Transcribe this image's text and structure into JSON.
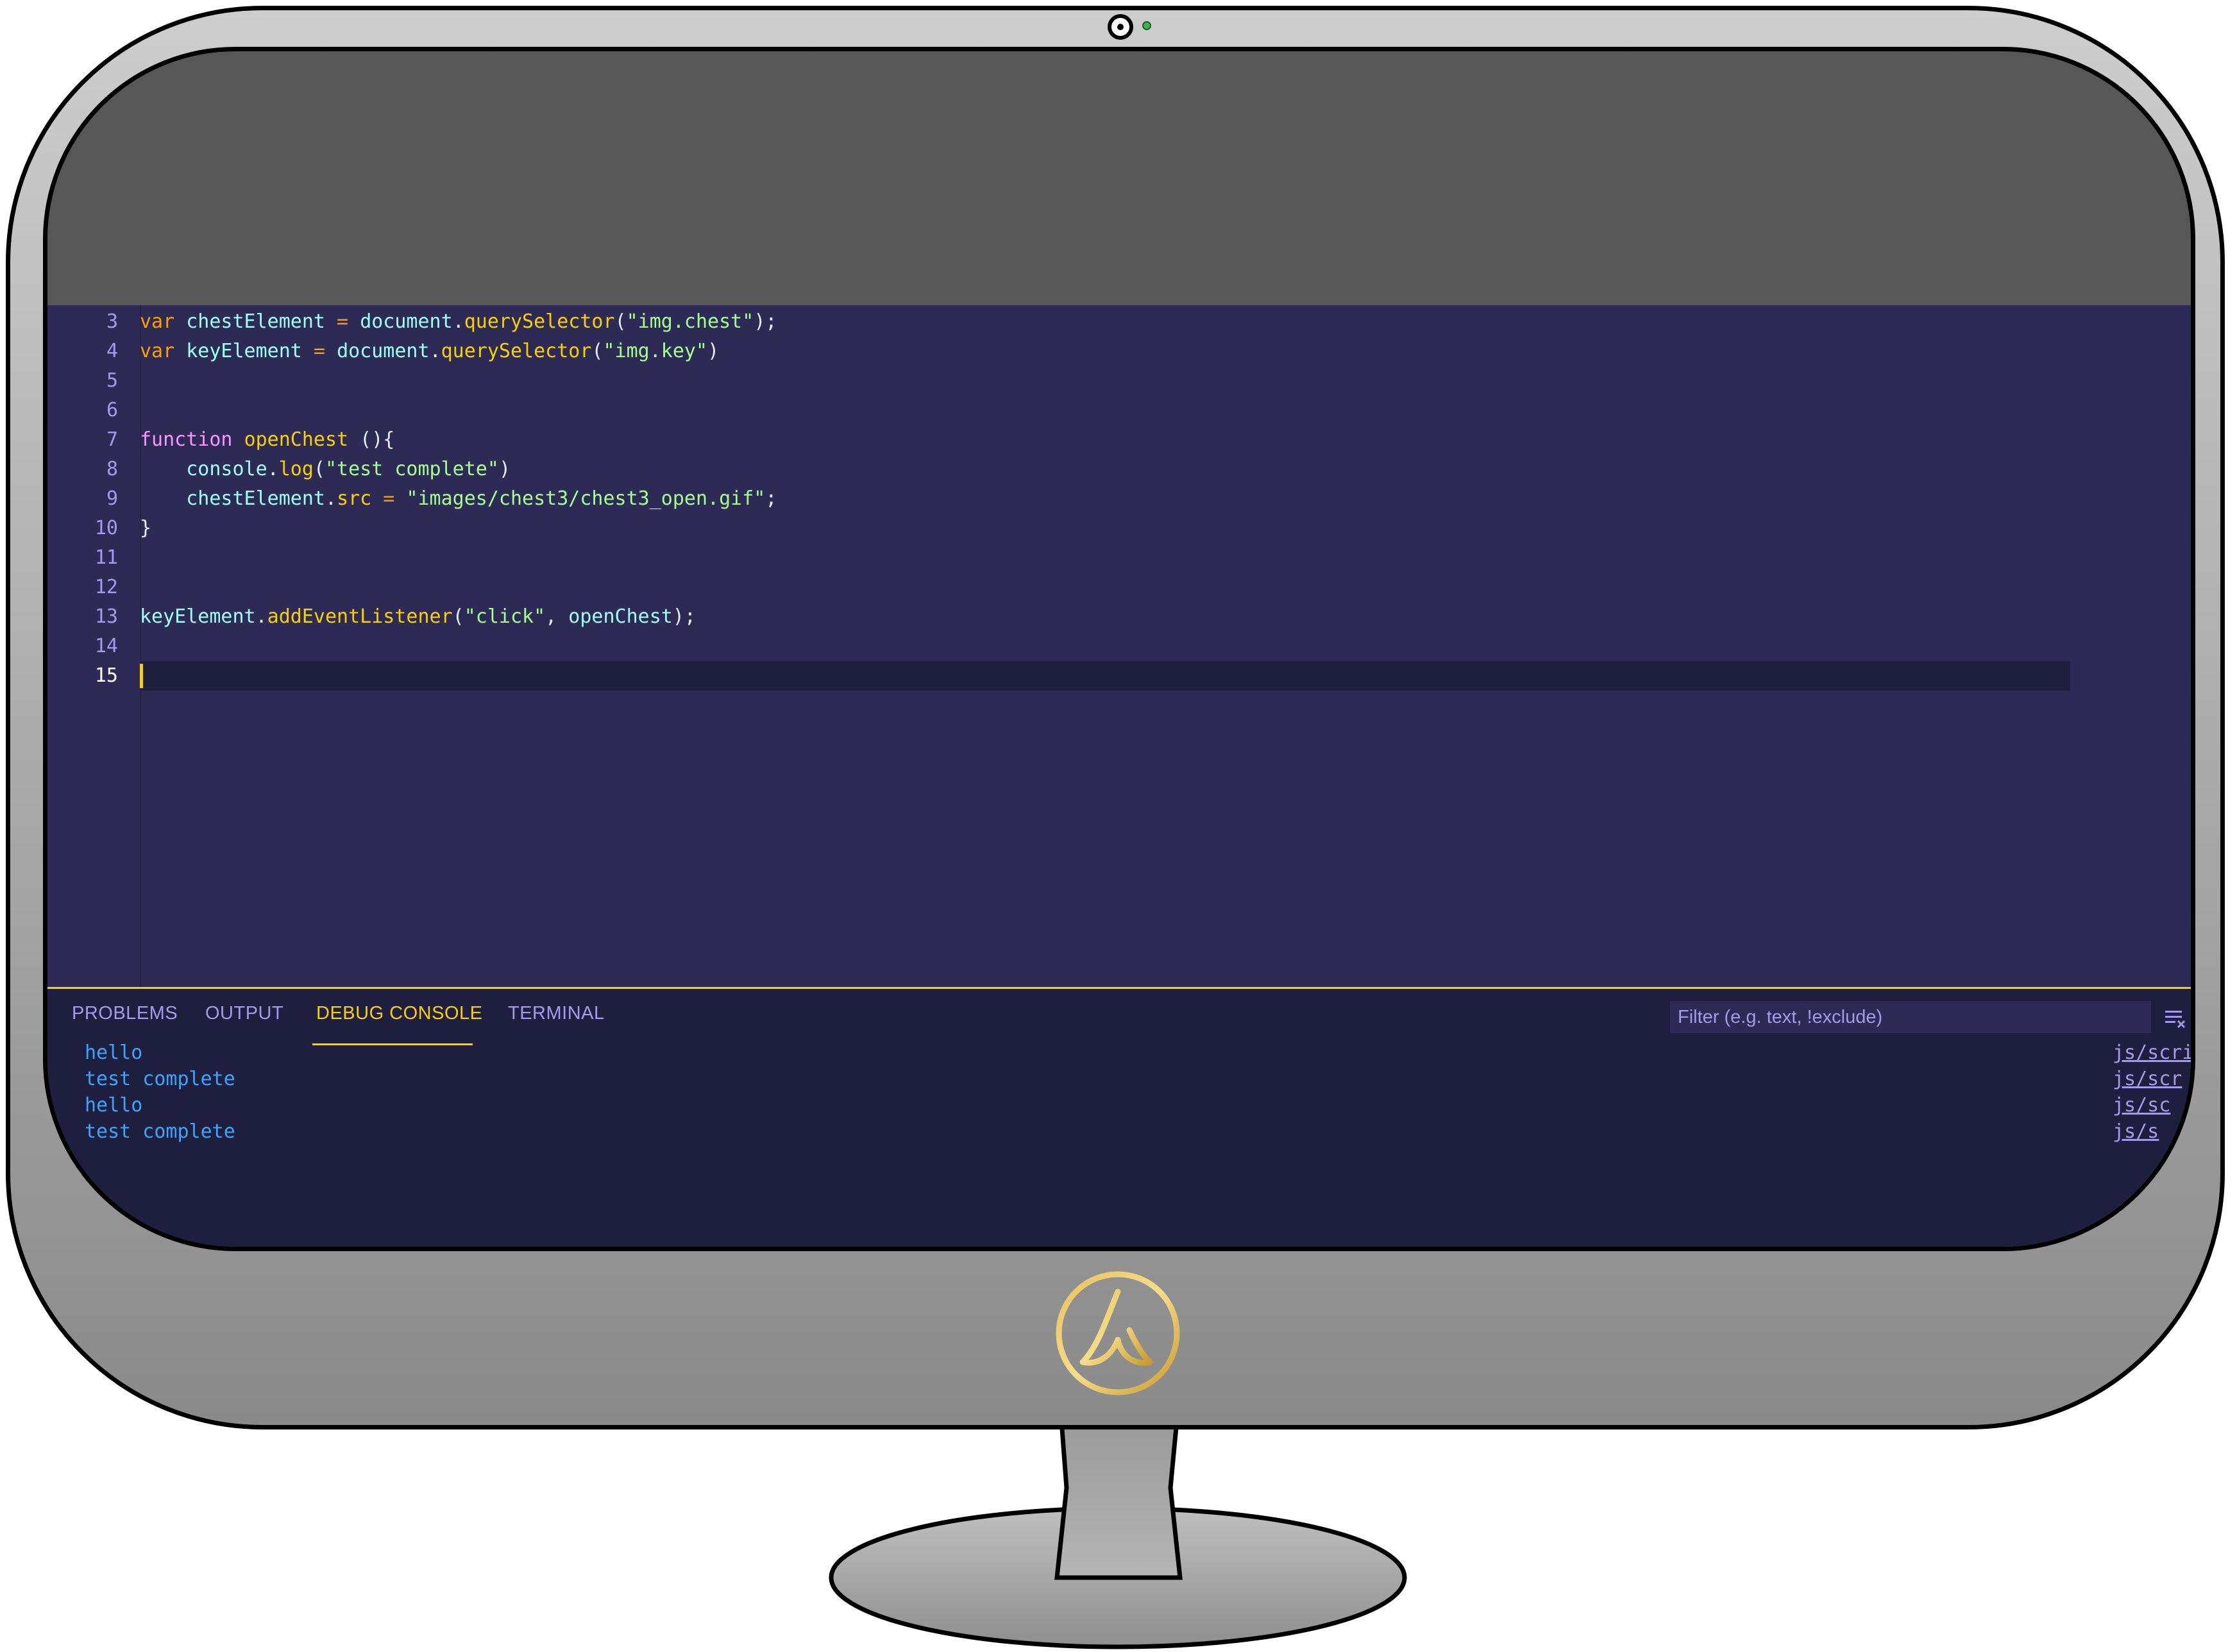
{
  "editor": {
    "lines": [
      {
        "num": "3",
        "tokens": [
          {
            "t": "var",
            "c": "kw"
          },
          {
            "t": " ",
            "c": "pl"
          },
          {
            "t": "chestElement",
            "c": "id"
          },
          {
            "t": " = ",
            "c": "pk"
          },
          {
            "t": "document",
            "c": "id"
          },
          {
            "t": ".",
            "c": "pl"
          },
          {
            "t": "querySelector",
            "c": "fn"
          },
          {
            "t": "(",
            "c": "pl"
          },
          {
            "t": "\"img.chest\"",
            "c": "str"
          },
          {
            "t": ");",
            "c": "pl"
          }
        ]
      },
      {
        "num": "4",
        "tokens": [
          {
            "t": "var",
            "c": "kw"
          },
          {
            "t": " ",
            "c": "pl"
          },
          {
            "t": "keyElement",
            "c": "id"
          },
          {
            "t": " = ",
            "c": "pk"
          },
          {
            "t": "document",
            "c": "id"
          },
          {
            "t": ".",
            "c": "pl"
          },
          {
            "t": "querySelector",
            "c": "fn"
          },
          {
            "t": "(",
            "c": "pl"
          },
          {
            "t": "\"img.key\"",
            "c": "str"
          },
          {
            "t": ")",
            "c": "pl"
          }
        ]
      },
      {
        "num": "5",
        "tokens": []
      },
      {
        "num": "6",
        "tokens": []
      },
      {
        "num": "7",
        "tokens": [
          {
            "t": "function",
            "c": "purp"
          },
          {
            "t": " ",
            "c": "pl"
          },
          {
            "t": "openChest",
            "c": "fn"
          },
          {
            "t": " (){",
            "c": "pl"
          }
        ]
      },
      {
        "num": "8",
        "tokens": [
          {
            "t": "    ",
            "c": "pl"
          },
          {
            "t": "console",
            "c": "id"
          },
          {
            "t": ".",
            "c": "pl"
          },
          {
            "t": "log",
            "c": "fn"
          },
          {
            "t": "(",
            "c": "pl"
          },
          {
            "t": "\"test complete\"",
            "c": "str"
          },
          {
            "t": ")",
            "c": "pl"
          }
        ]
      },
      {
        "num": "9",
        "tokens": [
          {
            "t": "    ",
            "c": "pl"
          },
          {
            "t": "chestElement",
            "c": "id"
          },
          {
            "t": ".",
            "c": "pl"
          },
          {
            "t": "src",
            "c": "fn"
          },
          {
            "t": " = ",
            "c": "pk"
          },
          {
            "t": "\"images/chest3/chest3_open.gif\"",
            "c": "str"
          },
          {
            "t": ";",
            "c": "pl"
          }
        ]
      },
      {
        "num": "10",
        "tokens": [
          {
            "t": "}",
            "c": "pl"
          }
        ]
      },
      {
        "num": "11",
        "tokens": []
      },
      {
        "num": "12",
        "tokens": []
      },
      {
        "num": "13",
        "tokens": [
          {
            "t": "keyElement",
            "c": "id"
          },
          {
            "t": ".",
            "c": "pl"
          },
          {
            "t": "addEventListener",
            "c": "fn"
          },
          {
            "t": "(",
            "c": "pl"
          },
          {
            "t": "\"click\"",
            "c": "str"
          },
          {
            "t": ", ",
            "c": "pl"
          },
          {
            "t": "openChest",
            "c": "id"
          },
          {
            "t": ");",
            "c": "pl"
          }
        ]
      },
      {
        "num": "14",
        "tokens": []
      },
      {
        "num": "15",
        "tokens": [],
        "active": true
      }
    ]
  },
  "panel": {
    "tabs": [
      {
        "label": "PROBLEMS",
        "active": false
      },
      {
        "label": "OUTPUT",
        "active": false
      },
      {
        "label": "DEBUG CONSOLE",
        "active": true
      },
      {
        "label": "TERMINAL",
        "active": false
      }
    ],
    "filter_placeholder": "Filter (e.g. text, !exclude)",
    "console": [
      {
        "text": "hello",
        "source": "js/scri"
      },
      {
        "text": "test complete",
        "source": "js/scr"
      },
      {
        "text": "hello",
        "source": "js/sc"
      },
      {
        "text": "test complete",
        "source": "js/s"
      }
    ]
  },
  "colors": {
    "editor_bg": "#2d2a55",
    "panel_bg": "#1e1e3f",
    "accent": "#fad000",
    "keyword": "#ff9d00",
    "string": "#a5ff90",
    "identifier": "#9effff",
    "console_text": "#3aa5ff"
  },
  "icons": {
    "camera": "camera-icon",
    "logo": "brand-logo-icon",
    "filter_clear": "clear-console-icon"
  }
}
